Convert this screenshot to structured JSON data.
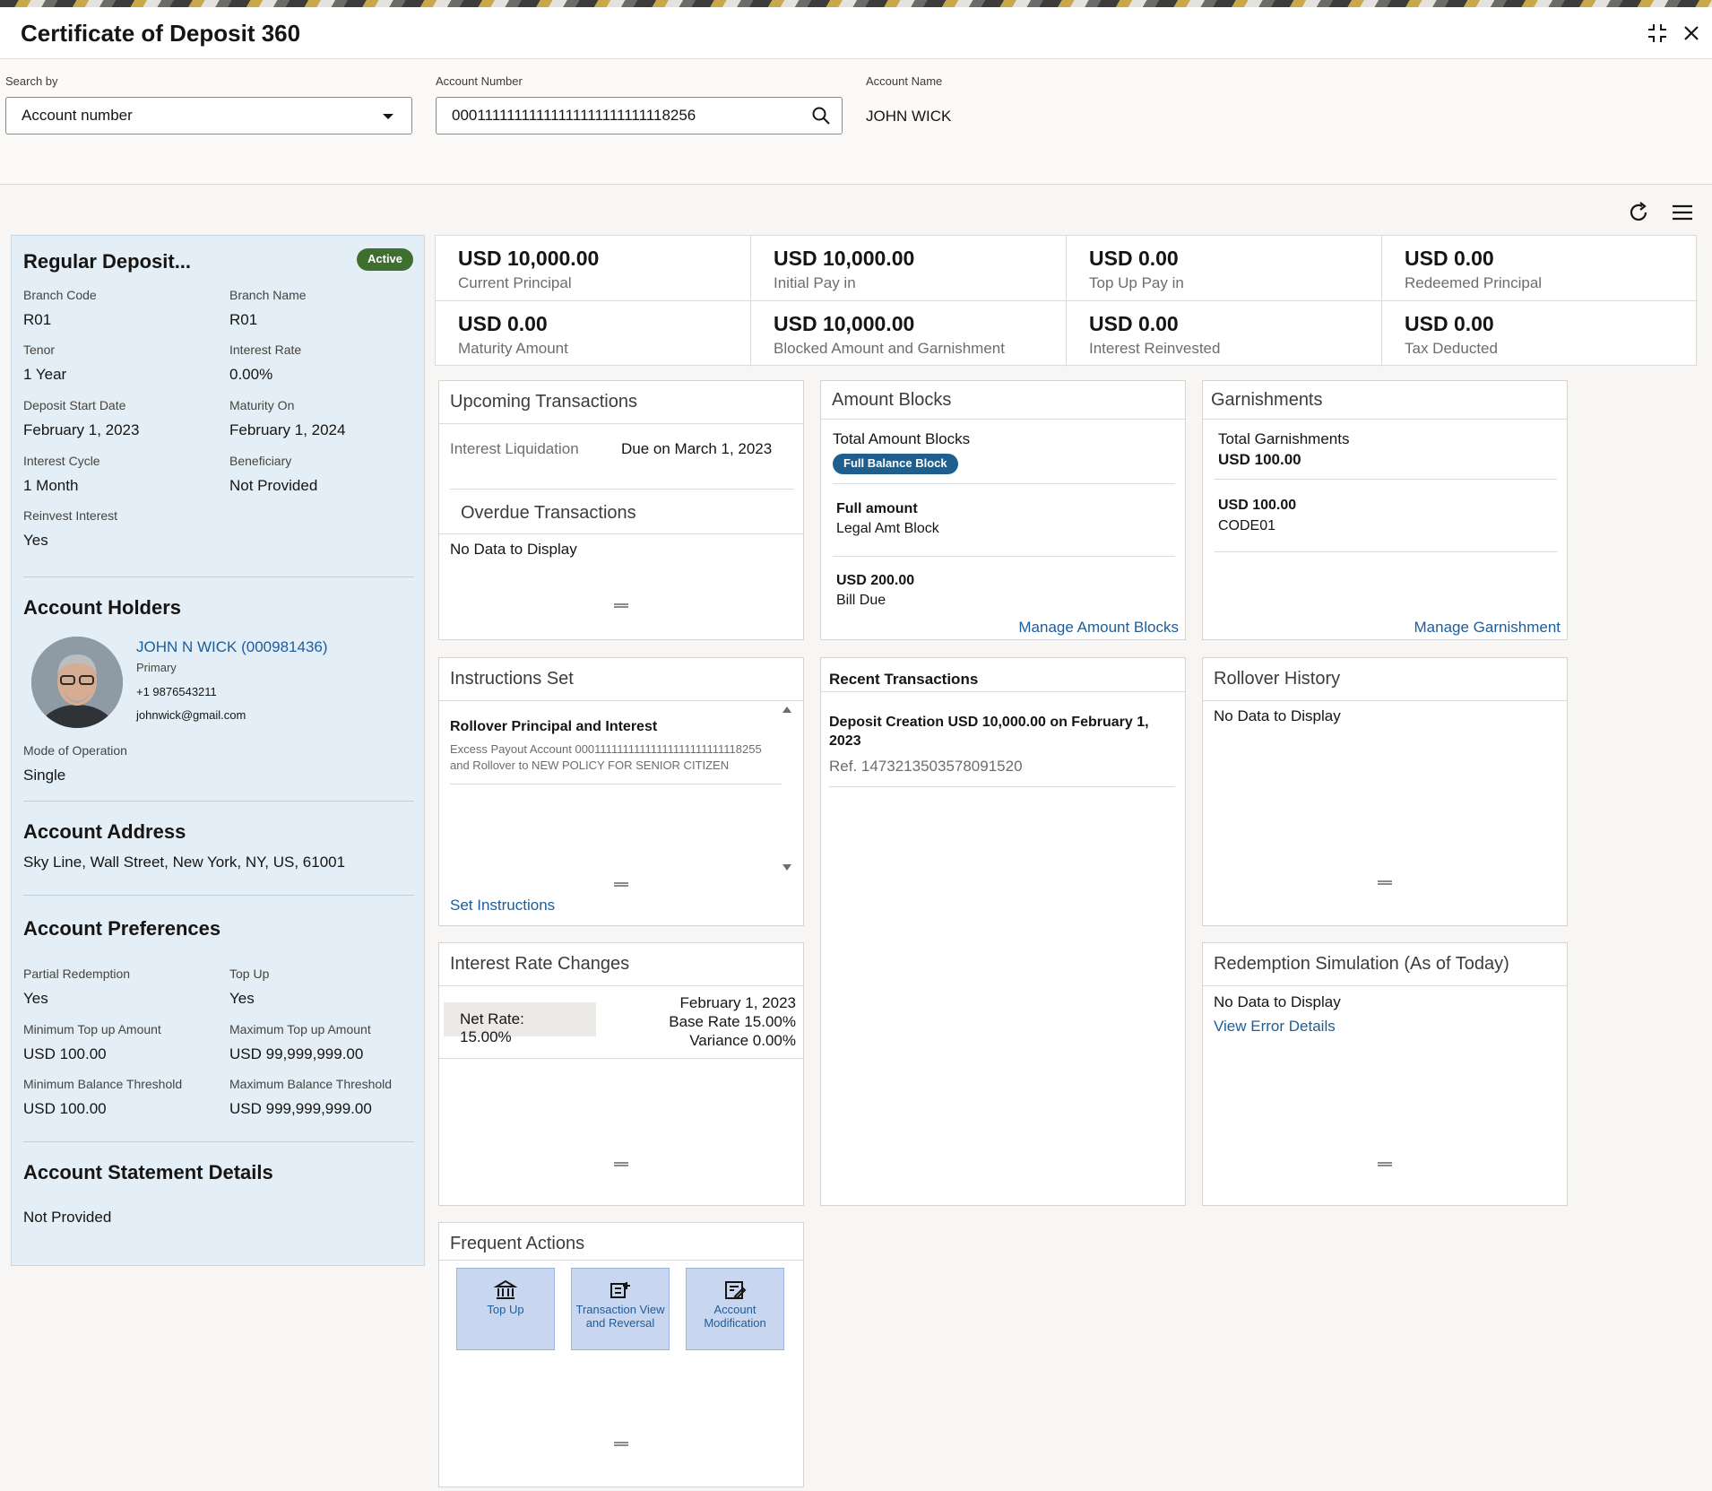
{
  "app": {
    "title": "Certificate of Deposit 360"
  },
  "search": {
    "search_by_label": "Search by",
    "search_by_value": "Account number",
    "account_number_label": "Account Number",
    "account_number_value": "00011111111111111111111111118256",
    "account_name_label": "Account Name",
    "account_name_value": "JOHN WICK"
  },
  "summary": {
    "title": "Regular Deposit...",
    "status": "Active",
    "status_color": "#3f6f2f",
    "fields": [
      {
        "label": "Branch Code",
        "value": "R01"
      },
      {
        "label": "Branch Name",
        "value": "R01"
      },
      {
        "label": "Tenor",
        "value": "1 Year"
      },
      {
        "label": "Interest Rate",
        "value": "0.00%"
      },
      {
        "label": "Deposit Start Date",
        "value": "February 1, 2023"
      },
      {
        "label": "Maturity On",
        "value": "February 1, 2024"
      },
      {
        "label": "Interest Cycle",
        "value": "1 Month"
      },
      {
        "label": "Beneficiary",
        "value": "Not Provided"
      },
      {
        "label": "Reinvest Interest",
        "value": "Yes"
      }
    ],
    "holders_title": "Account Holders",
    "holder": {
      "name": "JOHN N WICK (000981436)",
      "role": "Primary",
      "phone": "+1 9876543211",
      "email": "johnwick@gmail.com"
    },
    "mode_label": "Mode of Operation",
    "mode_value": "Single",
    "address_title": "Account Address",
    "address_value": "Sky Line, Wall Street, New York, NY, US, 61001",
    "preferences_title": "Account Preferences",
    "preferences": [
      {
        "label": "Partial Redemption",
        "value": "Yes"
      },
      {
        "label": "Top Up",
        "value": "Yes"
      },
      {
        "label": "Minimum Top up Amount",
        "value": "USD 100.00"
      },
      {
        "label": "Maximum Top up Amount",
        "value": "USD 99,999,999.00"
      },
      {
        "label": "Minimum Balance Threshold",
        "value": "USD 100.00"
      },
      {
        "label": "Maximum Balance Threshold",
        "value": "USD 999,999,999.00"
      }
    ],
    "statement_title": "Account Statement Details",
    "statement_value": "Not Provided"
  },
  "stats": [
    {
      "amount": "USD 10,000.00",
      "label": "Current Principal"
    },
    {
      "amount": "USD 10,000.00",
      "label": "Initial Pay in"
    },
    {
      "amount": "USD 0.00",
      "label": "Top Up Pay in"
    },
    {
      "amount": "USD 0.00",
      "label": "Redeemed Principal"
    },
    {
      "amount": "USD 0.00",
      "label": "Maturity Amount"
    },
    {
      "amount": "USD 10,000.00",
      "label": "Blocked Amount and Garnishment"
    },
    {
      "amount": "USD 0.00",
      "label": "Interest Reinvested"
    },
    {
      "amount": "USD 0.00",
      "label": "Tax Deducted"
    }
  ],
  "upcoming": {
    "title": "Upcoming Transactions",
    "item_label": "Interest Liquidation",
    "item_value": "Due on March 1, 2023",
    "overdue_title": "Overdue Transactions",
    "overdue_empty": "No Data to Display"
  },
  "amount_blocks": {
    "title": "Amount Blocks",
    "total_label": "Total Amount Blocks",
    "pill": "Full Balance Block",
    "items": [
      {
        "title": "Full amount",
        "sub": "Legal Amt Block"
      },
      {
        "title": "USD 200.00",
        "sub": "Bill Due"
      }
    ],
    "link": "Manage Amount Blocks"
  },
  "garnishments": {
    "title": "Garnishments",
    "total_label": "Total Garnishments",
    "total_value": "USD 100.00",
    "item_amount": "USD 100.00",
    "item_code": "CODE01",
    "link": "Manage Garnishment"
  },
  "instructions": {
    "title": "Instructions Set",
    "item_title": "Rollover Principal and Interest",
    "item_desc_1": "Excess Payout Account 00011111111111111111111111118255",
    "item_desc_2": "and Rollover to NEW POLICY FOR SENIOR CITIZEN",
    "link": "Set Instructions"
  },
  "recent": {
    "title": "Recent Transactions",
    "item_title_1": "Deposit Creation USD 10,000.00 on February 1,",
    "item_title_2": "2023",
    "item_ref": "Ref. 1473213503578091520"
  },
  "rollover": {
    "title": "Rollover History",
    "empty": "No Data to Display"
  },
  "interest_rate": {
    "title": "Interest Rate Changes",
    "net_rate": "Net Rate: 15.00%",
    "date": "February 1, 2023",
    "base_rate": "Base Rate 15.00%",
    "variance": "Variance 0.00%"
  },
  "redemption": {
    "title": "Redemption Simulation (As of Today)",
    "empty": "No Data to Display",
    "link": "View Error Details"
  },
  "frequent": {
    "title": "Frequent Actions",
    "actions": [
      {
        "label_1": "Top Up",
        "label_2": "",
        "icon": "bank-icon"
      },
      {
        "label_1": "Transaction View",
        "label_2": "and Reversal",
        "icon": "transaction-icon"
      },
      {
        "label_1": "Account",
        "label_2": "Modification",
        "icon": "edit-document-icon"
      }
    ]
  }
}
